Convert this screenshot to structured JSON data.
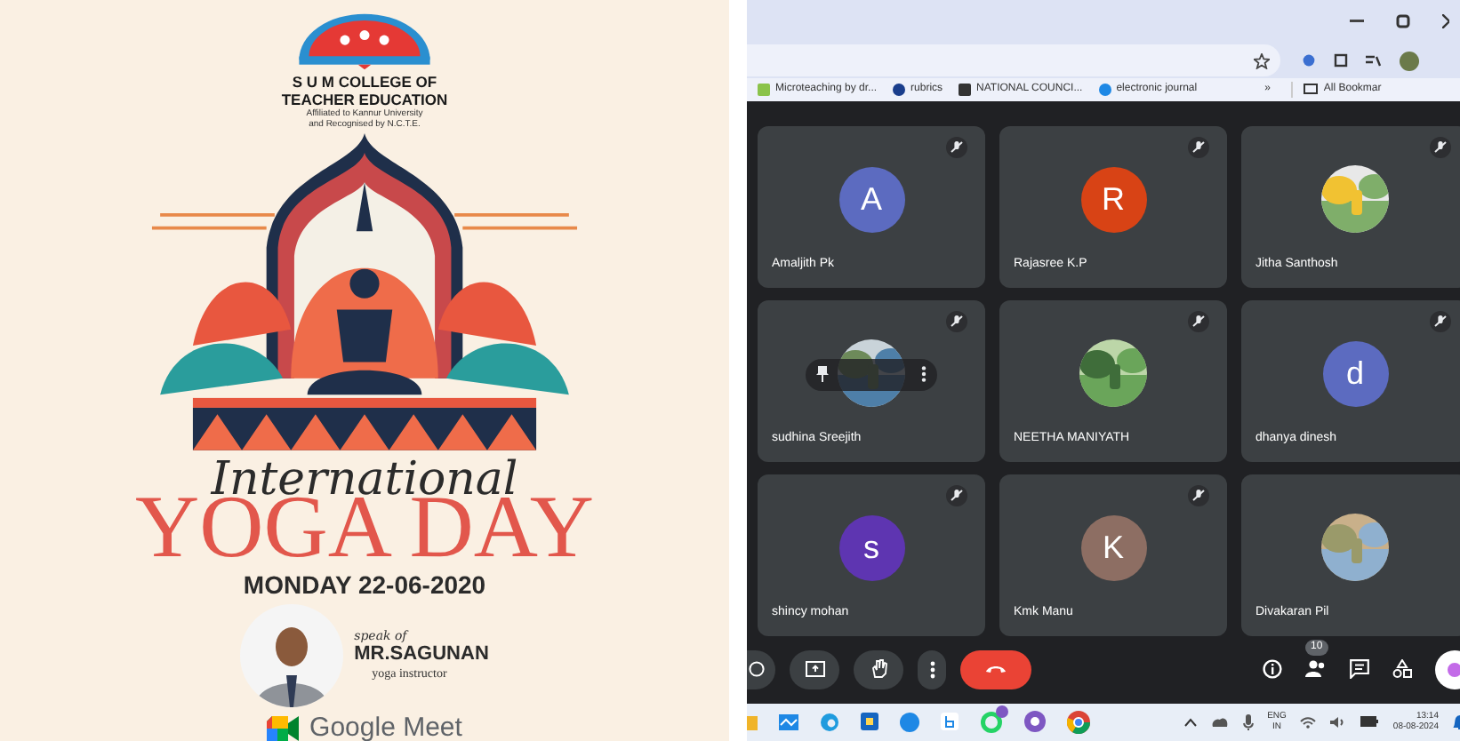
{
  "poster": {
    "college_lines": [
      "S U M COLLEGE OF",
      "TEACHER EDUCATION"
    ],
    "affiliation_lines": [
      "Affiliated to Kannur University",
      "and Recognised by N.C.T.E."
    ],
    "script_title": "International",
    "title": "YOGA DAY",
    "date": "MONDAY 22-06-2020",
    "speaker_intro": "speak of",
    "speaker_name": "MR.SAGUNAN",
    "speaker_role": "yoga instructor",
    "platform": "Google Meet"
  },
  "browser": {
    "bookmarks": [
      {
        "label": "Microteaching by dr..."
      },
      {
        "label": "rubrics"
      },
      {
        "label": "NATIONAL COUNCI..."
      },
      {
        "label": "electronic journal"
      }
    ],
    "more_bookmarks": "»",
    "all_bookmarks": "All Bookmar"
  },
  "participants": [
    {
      "name": "Amaljith Pk",
      "kind": "initial",
      "initial": "A",
      "color": "#5c6bc0",
      "muted": true,
      "hover_controls": false
    },
    {
      "name": "Rajasree K.P",
      "kind": "initial",
      "initial": "R",
      "color": "#d84315",
      "muted": true,
      "hover_controls": false
    },
    {
      "name": "Jitha Santhosh",
      "muted": true,
      "hover_controls": false
    },
    {
      "name": "sudhina Sreejith",
      "muted": true,
      "hover_controls": true
    },
    {
      "name": "NEETHA MANIYATH",
      "muted": true,
      "hover_controls": false
    },
    {
      "name": "dhanya dinesh",
      "kind": "initial",
      "initial": "d",
      "color": "#5c6bc0",
      "muted": true,
      "hover_controls": false
    },
    {
      "name": "shincy mohan",
      "kind": "initial",
      "initial": "s",
      "color": "#5e35b1",
      "muted": true,
      "hover_controls": false
    },
    {
      "name": "Kmk Manu",
      "kind": "initial",
      "initial": "K",
      "color": "#8d6e63",
      "muted": true,
      "hover_controls": false
    },
    {
      "name": "Divakaran Pil",
      "muted": false,
      "hover_controls": false
    }
  ],
  "meeting_controls": {
    "people_count": "10"
  },
  "taskbar": {
    "language": "ENG",
    "region": "IN",
    "time": "13:14",
    "date": "08-08-2024"
  }
}
